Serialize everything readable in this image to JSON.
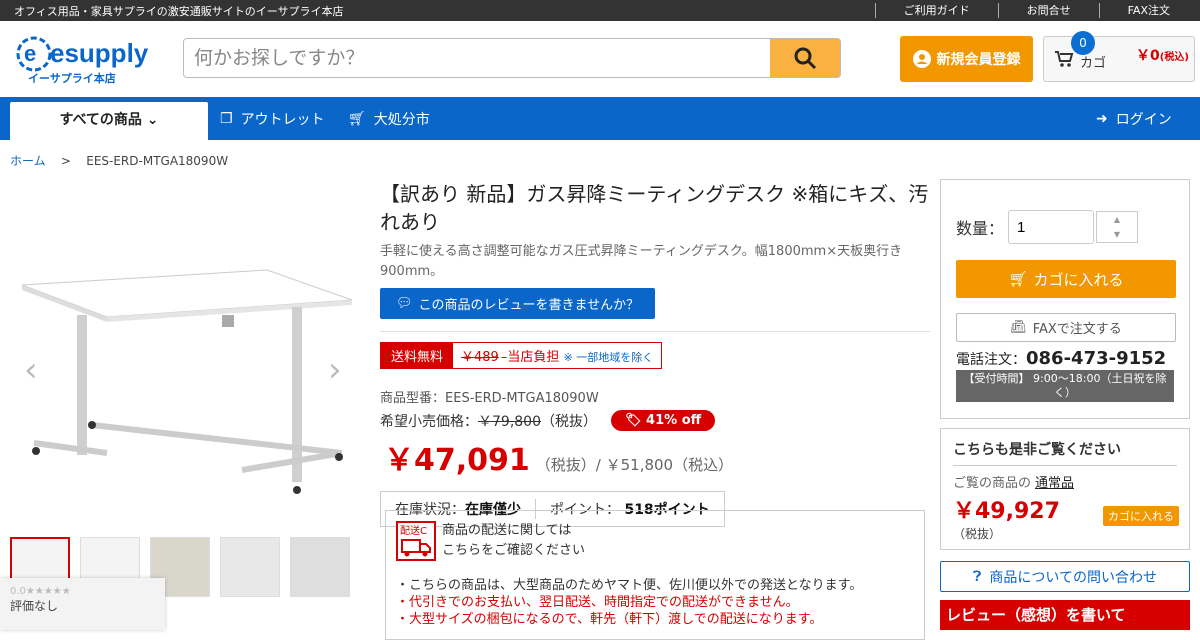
{
  "topbar": {
    "tagline": "オフィス用品・家具サプライの激安通販サイトのイーサプライ本店",
    "links": [
      "ご利用ガイド",
      "お問合せ",
      "FAX注文"
    ]
  },
  "header": {
    "logo_text": "esupply",
    "logo_sub": "イーサプライ本店",
    "search_placeholder": "何かお探しですか？",
    "register_label": "新規会員登録",
    "cart_label": "カゴ",
    "cart_count": "0",
    "cart_price": "￥0",
    "cart_price_tax": "(税込)"
  },
  "nav": {
    "all_products": "すべての商品",
    "outlet": "アウトレット",
    "clearance": "大処分市",
    "login": "ログイン"
  },
  "breadcrumb": {
    "home": "ホーム",
    "sep": ">",
    "current": "EES-ERD-MTGA18090W"
  },
  "product": {
    "title": "【訳あり 新品】ガス昇降ミーティングデスク ※箱にキズ、汚れあり",
    "description": "手軽に使える高さ調整可能なガス圧式昇降ミーティングデスク。幅1800mm×天板奥行き900mm。",
    "review_button": "この商品のレビューを書きませんか？",
    "shipping_free": "送料無料",
    "shipping_old": "￥489",
    "shipping_burden": "当店負担",
    "shipping_note": "※ 一部地域を除く",
    "model_label": "商品型番：",
    "model": "EES-ERD-MTGA18090W",
    "list_price_label": "希望小売価格：",
    "list_price": "￥79,800",
    "list_price_tax": "（税抜）",
    "discount": "41% off",
    "price": "￥47,091",
    "price_tax": "（税抜）/ ￥51,800（税込）",
    "stock_label": "在庫状況：",
    "stock_value": "在庫僅少",
    "point_label": "ポイント：",
    "point_value": "518ポイント"
  },
  "rating": {
    "score": "0.0",
    "stars": "★★★★★",
    "text": "評価なし"
  },
  "delivery": {
    "badge": "配送C",
    "head1": "商品の配送に関しては",
    "head2": "こちらをご確認ください",
    "line1": "・こちらの商品は、大型商品のためヤマト便、佐川便以外での発送となります。",
    "line2": "・代引きでのお支払い、翌日配送、時間指定での配送ができません。",
    "line3": "・大型サイズの梱包になるので、軒先（軒下）渡しでの配送になります。"
  },
  "sidebar": {
    "qty_label": "数量：",
    "qty_value": "1",
    "add_to_cart": "カゴに入れる",
    "fax_order": "FAXで注文する",
    "tel_label": "電話注文：",
    "tel": "086-473-9152",
    "hours": "【受付時間】 9:00～18:00（土日祝を除く）"
  },
  "also": {
    "heading": "こちらも是非ご覧ください",
    "viewing_label": "ご覧の商品の",
    "viewing_link": "通常品",
    "price": "￥49,927",
    "tax": "（税抜）",
    "button": "カゴに入れる"
  },
  "inquiry": "商品についての問い合わせ",
  "banner": "レビュー（感想）を書いて",
  "colors": {
    "brand_blue": "#0a66c8",
    "accent_orange": "#f39700",
    "price_red": "#d60000"
  }
}
